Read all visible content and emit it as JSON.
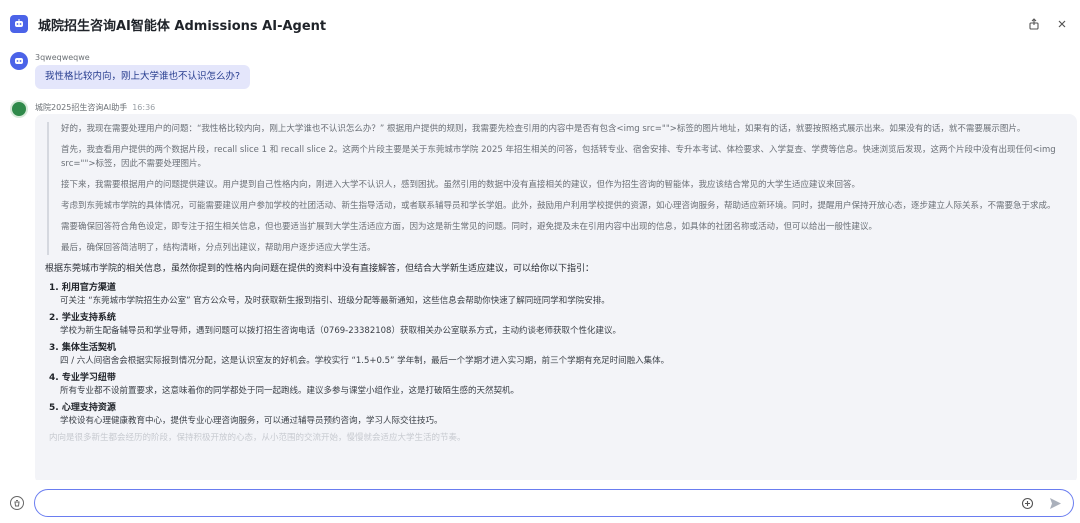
{
  "app": {
    "title": "城院招生咨询AI智能体 Admissions AI-Agent"
  },
  "icons": {
    "app_logo": "bot-logo-icon",
    "share": "share-icon",
    "close": "close-icon",
    "clear": "clear-chat-icon",
    "add": "add-circle-icon",
    "send": "send-icon"
  },
  "user_message": {
    "name": "3qweqweqwe",
    "text": "我性格比较内向，刚上大学谁也不认识怎么办?"
  },
  "bot_message": {
    "name": "城院2025招生咨询AI助手",
    "time": "16:36",
    "thinking": [
      "好的，我现在需要处理用户的问题：“我性格比较内向，刚上大学谁也不认识怎么办？” 根据用户提供的规则，我需要先检查引用的内容中是否有包含<img src=\"\">标签的图片地址，如果有的话，就要按照格式展示出来。如果没有的话，就不需要展示图片。",
      "首先，我查看用户提供的两个数据片段，recall slice 1 和 recall slice 2。这两个片段主要是关于东莞城市学院 2025 年招生相关的问答，包括转专业、宿舍安排、专升本考试、体检要求、入学复查、学费等信息。快速浏览后发现，这两个片段中没有出现任何<img src=\"\">标签，因此不需要处理图片。",
      "接下来，我需要根据用户的问题提供建议。用户提到自己性格内向，刚进入大学不认识人，感到困扰。虽然引用的数据中没有直接相关的建议，但作为招生咨询的智能体，我应该结合常见的大学生适应建议来回答。",
      "考虑到东莞城市学院的具体情况，可能需要建议用户参加学校的社团活动、新生指导活动，或者联系辅导员和学长学姐。此外，鼓励用户利用学校提供的资源，如心理咨询服务，帮助适应新环境。同时，提醒用户保持开放心态，逐步建立人际关系，不需要急于求成。",
      "需要确保回答符合角色设定，即专注于招生相关信息，但也要适当扩展到大学生活适应方面，因为这是新生常见的问题。同时，避免提及未在引用内容中出现的信息，如具体的社团名称或活动，但可以给出一般性建议。",
      "最后，确保回答简洁明了，结构清晰，分点列出建议，帮助用户逐步适应大学生活。"
    ],
    "answer_intro": "根据东莞城市学院的相关信息，虽然你提到的性格内向问题在提供的资料中没有直接解答，但结合大学新生适应建议，可以给你以下指引：",
    "answer_items": [
      {
        "title": "1. 利用官方渠道",
        "desc": "可关注 “东莞城市学院招生办公室” 官方公众号，及时获取新生报到指引、班级分配等最新通知，这些信息会帮助你快速了解同班同学和学院安排。"
      },
      {
        "title": "2. 学业支持系统",
        "desc": "学校为新生配备辅导员和学业导师，遇到问题可以拨打招生咨询电话（0769-23382108）获取相关办公室联系方式，主动约谈老师获取个性化建议。"
      },
      {
        "title": "3. 集体生活契机",
        "desc": "四 / 六人间宿舍会根据实际报到情况分配，这是认识室友的好机会。学校实行 “1.5+0.5” 学年制，最后一个学期才进入实习期，前三个学期有充足时间融入集体。"
      },
      {
        "title": "4. 专业学习纽带",
        "desc": "所有专业都不设前置要求，这意味着你的同学都处于同一起跑线。建议多参与课堂小组作业，这是打破陌生感的天然契机。"
      },
      {
        "title": "5. 心理支持资源",
        "desc": "学校设有心理健康教育中心，提供专业心理咨询服务，可以通过辅导员预约咨询，学习人际交往技巧。"
      }
    ],
    "faded_text": "内向是很多新生都会经历的阶段，保持积极开放的心态，从小范围的交流开始，慢慢就会适应大学生活的节奏。"
  },
  "input": {
    "placeholder": "",
    "value": ""
  }
}
